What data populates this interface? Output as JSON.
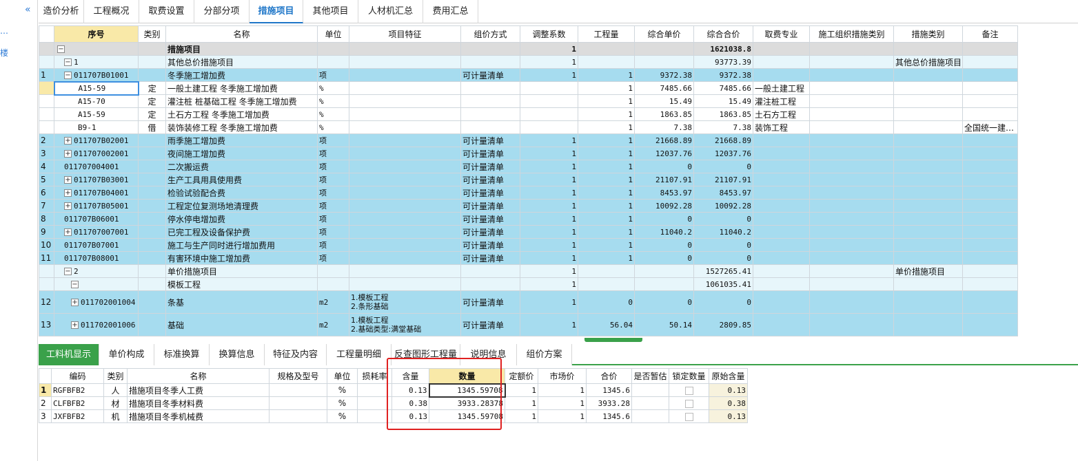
{
  "sidebar": {
    "collapse_icon": "«",
    "dots": "…",
    "label": "楼"
  },
  "tabs": [
    "造价分析",
    "工程概况",
    "取费设置",
    "分部分项",
    "措施项目",
    "其他项目",
    "人材机汇总",
    "费用汇总"
  ],
  "active_tab": 4,
  "grid": {
    "headers": [
      "序号",
      "类别",
      "名称",
      "单位",
      "项目特征",
      "组价方式",
      "调整系数",
      "工程量",
      "综合单价",
      "综合合价",
      "取费专业",
      "施工组织措施类别",
      "措施类别",
      "备注"
    ],
    "rows": [
      {
        "type": "dark",
        "level": 0,
        "tog": "−",
        "seq": "",
        "code": "",
        "cat": "",
        "name": "措施项目",
        "unit": "",
        "feat": "",
        "method": "",
        "coef": "1",
        "qty": "",
        "price": "",
        "total": "1621038.8",
        "prof": "",
        "org": "",
        "mtype": "",
        "note": ""
      },
      {
        "type": "lb",
        "level": 1,
        "tog": "−",
        "seq": "",
        "code": "1",
        "cat": "",
        "name": "其他总价措施项目",
        "unit": "",
        "feat": "",
        "method": "",
        "coef": "1",
        "qty": "",
        "price": "",
        "total": "93773.39",
        "prof": "",
        "org": "",
        "mtype": "其他总价措施项目",
        "note": ""
      },
      {
        "type": "cy",
        "level": 1,
        "tog": "−",
        "seq": "1",
        "code": "011707B01001",
        "cat": "",
        "name": "冬季施工增加费",
        "unit": "项",
        "feat": "",
        "method": "可计量清单",
        "coef": "1",
        "qty": "1",
        "price": "9372.38",
        "total": "9372.38",
        "prof": "",
        "org": "",
        "mtype": "",
        "note": ""
      },
      {
        "type": "wh",
        "level": 3,
        "tog": "",
        "seq": "",
        "code": "A15-59",
        "cat": "定",
        "name": "一般土建工程 冬季施工增加费",
        "unit": "%",
        "feat": "",
        "method": "",
        "coef": "",
        "qty": "1",
        "price": "7485.66",
        "total": "7485.66",
        "prof": "一般土建工程",
        "org": "",
        "mtype": "",
        "note": "",
        "sel": true
      },
      {
        "type": "wh",
        "level": 3,
        "tog": "",
        "seq": "",
        "code": "A15-70",
        "cat": "定",
        "name": "灌注桩 桩基础工程 冬季施工增加费",
        "unit": "%",
        "feat": "",
        "method": "",
        "coef": "",
        "qty": "1",
        "price": "15.49",
        "total": "15.49",
        "prof": "灌注桩工程",
        "org": "",
        "mtype": "",
        "note": ""
      },
      {
        "type": "wh",
        "level": 3,
        "tog": "",
        "seq": "",
        "code": "A15-59",
        "cat": "定",
        "name": "土石方工程 冬季施工增加费",
        "unit": "%",
        "feat": "",
        "method": "",
        "coef": "",
        "qty": "1",
        "price": "1863.85",
        "total": "1863.85",
        "prof": "土石方工程",
        "org": "",
        "mtype": "",
        "note": ""
      },
      {
        "type": "wh",
        "level": 3,
        "tog": "",
        "seq": "",
        "code": "B9-1",
        "cat": "借",
        "name": "装饰装修工程 冬季施工增加费",
        "unit": "%",
        "feat": "",
        "method": "",
        "coef": "",
        "qty": "1",
        "price": "7.38",
        "total": "7.38",
        "prof": "装饰工程",
        "org": "",
        "mtype": "",
        "note": "全国统一建…"
      },
      {
        "type": "cy",
        "level": 1,
        "tog": "+",
        "seq": "2",
        "code": "011707B02001",
        "cat": "",
        "name": "雨季施工增加费",
        "unit": "项",
        "feat": "",
        "method": "可计量清单",
        "coef": "1",
        "qty": "1",
        "price": "21668.89",
        "total": "21668.89",
        "prof": "",
        "org": "",
        "mtype": "",
        "note": ""
      },
      {
        "type": "cy",
        "level": 1,
        "tog": "+",
        "seq": "3",
        "code": "011707002001",
        "cat": "",
        "name": "夜间施工增加费",
        "unit": "项",
        "feat": "",
        "method": "可计量清单",
        "coef": "1",
        "qty": "1",
        "price": "12037.76",
        "total": "12037.76",
        "prof": "",
        "org": "",
        "mtype": "",
        "note": ""
      },
      {
        "type": "cy",
        "level": 1,
        "tog": "",
        "seq": "4",
        "code": "011707004001",
        "cat": "",
        "name": "二次搬运费",
        "unit": "项",
        "feat": "",
        "method": "可计量清单",
        "coef": "1",
        "qty": "1",
        "price": "0",
        "total": "0",
        "prof": "",
        "org": "",
        "mtype": "",
        "note": ""
      },
      {
        "type": "cy",
        "level": 1,
        "tog": "+",
        "seq": "5",
        "code": "011707B03001",
        "cat": "",
        "name": "生产工具用具使用费",
        "unit": "项",
        "feat": "",
        "method": "可计量清单",
        "coef": "1",
        "qty": "1",
        "price": "21107.91",
        "total": "21107.91",
        "prof": "",
        "org": "",
        "mtype": "",
        "note": ""
      },
      {
        "type": "cy",
        "level": 1,
        "tog": "+",
        "seq": "6",
        "code": "011707B04001",
        "cat": "",
        "name": "检验试验配合费",
        "unit": "项",
        "feat": "",
        "method": "可计量清单",
        "coef": "1",
        "qty": "1",
        "price": "8453.97",
        "total": "8453.97",
        "prof": "",
        "org": "",
        "mtype": "",
        "note": ""
      },
      {
        "type": "cy",
        "level": 1,
        "tog": "+",
        "seq": "7",
        "code": "011707B05001",
        "cat": "",
        "name": "工程定位复测场地清理费",
        "unit": "项",
        "feat": "",
        "method": "可计量清单",
        "coef": "1",
        "qty": "1",
        "price": "10092.28",
        "total": "10092.28",
        "prof": "",
        "org": "",
        "mtype": "",
        "note": ""
      },
      {
        "type": "cy",
        "level": 1,
        "tog": "",
        "seq": "8",
        "code": "011707B06001",
        "cat": "",
        "name": "停水停电增加费",
        "unit": "项",
        "feat": "",
        "method": "可计量清单",
        "coef": "1",
        "qty": "1",
        "price": "0",
        "total": "0",
        "prof": "",
        "org": "",
        "mtype": "",
        "note": ""
      },
      {
        "type": "cy",
        "level": 1,
        "tog": "+",
        "seq": "9",
        "code": "011707007001",
        "cat": "",
        "name": "已完工程及设备保护费",
        "unit": "项",
        "feat": "",
        "method": "可计量清单",
        "coef": "1",
        "qty": "1",
        "price": "11040.2",
        "total": "11040.2",
        "prof": "",
        "org": "",
        "mtype": "",
        "note": ""
      },
      {
        "type": "cy",
        "level": 1,
        "tog": "",
        "seq": "10",
        "code": "011707B07001",
        "cat": "",
        "name": "施工与生产同时进行增加费用",
        "unit": "项",
        "feat": "",
        "method": "可计量清单",
        "coef": "1",
        "qty": "1",
        "price": "0",
        "total": "0",
        "prof": "",
        "org": "",
        "mtype": "",
        "note": ""
      },
      {
        "type": "cy",
        "level": 1,
        "tog": "",
        "seq": "11",
        "code": "011707B08001",
        "cat": "",
        "name": "有害环境中施工增加费",
        "unit": "项",
        "feat": "",
        "method": "可计量清单",
        "coef": "1",
        "qty": "1",
        "price": "0",
        "total": "0",
        "prof": "",
        "org": "",
        "mtype": "",
        "note": ""
      },
      {
        "type": "lb",
        "level": 1,
        "tog": "−",
        "seq": "",
        "code": "2",
        "cat": "",
        "name": "单价措施项目",
        "unit": "",
        "feat": "",
        "method": "",
        "coef": "1",
        "qty": "",
        "price": "",
        "total": "1527265.41",
        "prof": "",
        "org": "",
        "mtype": "单价措施项目",
        "note": ""
      },
      {
        "type": "lb",
        "level": 2,
        "tog": "−",
        "seq": "",
        "code": "",
        "cat": "",
        "name": "模板工程",
        "unit": "",
        "feat": "",
        "method": "",
        "coef": "1",
        "qty": "",
        "price": "",
        "total": "1061035.41",
        "prof": "",
        "org": "",
        "mtype": "",
        "note": ""
      },
      {
        "type": "cy",
        "level": 2,
        "tog": "+",
        "seq": "12",
        "code": "011702001004",
        "cat": "",
        "name": "条基",
        "unit": "m2",
        "feat": "1.模板工程\n2.条形基础",
        "method": "可计量清单",
        "coef": "1",
        "qty": "0",
        "price": "0",
        "total": "0",
        "prof": "",
        "org": "",
        "mtype": "",
        "note": "",
        "tall": true
      },
      {
        "type": "cy",
        "level": 2,
        "tog": "+",
        "seq": "13",
        "code": "011702001006",
        "cat": "",
        "name": "基础",
        "unit": "m2",
        "feat": "1.模板工程\n2.基础类型:满堂基础",
        "method": "可计量清单",
        "coef": "1",
        "qty": "56.04",
        "price": "50.14",
        "total": "2809.85",
        "prof": "",
        "org": "",
        "mtype": "",
        "note": "",
        "tall": true
      }
    ]
  },
  "bottom_tabs": [
    "工料机显示",
    "单价构成",
    "标准换算",
    "换算信息",
    "特征及内容",
    "工程量明细",
    "反查图形工程量",
    "说明信息",
    "组价方案"
  ],
  "bottom_active": 0,
  "sub": {
    "headers": [
      "",
      "编码",
      "类别",
      "名称",
      "规格及型号",
      "单位",
      "损耗率",
      "含量",
      "数量",
      "定额价",
      "市场价",
      "合价",
      "是否暂估",
      "锁定数量",
      "原始含量"
    ],
    "rows": [
      {
        "n": "1",
        "code": "RGFBFB2",
        "cat": "人",
        "name": "措施项目冬季人工费",
        "spec": "",
        "unit": "%",
        "loss": "",
        "content": "0.13",
        "qty": "1345.59708",
        "base": "1",
        "market": "1",
        "total": "1345.6",
        "orig": "0.13"
      },
      {
        "n": "2",
        "code": "CLFBFB2",
        "cat": "材",
        "name": "措施项目冬季材料费",
        "spec": "",
        "unit": "%",
        "loss": "",
        "content": "0.38",
        "qty": "3933.28378",
        "base": "1",
        "market": "1",
        "total": "3933.28",
        "orig": "0.38"
      },
      {
        "n": "3",
        "code": "JXFBFB2",
        "cat": "机",
        "name": "措施项目冬季机械费",
        "spec": "",
        "unit": "%",
        "loss": "",
        "content": "0.13",
        "qty": "1345.59708",
        "base": "1",
        "market": "1",
        "total": "1345.6",
        "orig": "0.13"
      }
    ]
  }
}
